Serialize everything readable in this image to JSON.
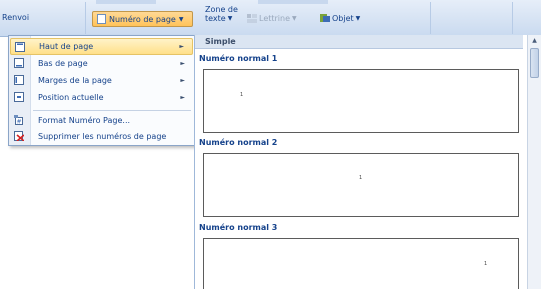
{
  "ribbon": {
    "renvoi": "Renvoi",
    "numero_de_page": "Numéro de page",
    "zone_de_texte_line1": "Zone de",
    "zone_de_texte_line2": "texte",
    "lettrine": "Lettrine",
    "objet": "Objet"
  },
  "menu": {
    "items": [
      {
        "label": "Haut de page",
        "has_submenu": true,
        "highlighted": true
      },
      {
        "label": "Bas de page",
        "has_submenu": true
      },
      {
        "label": "Marges de la page",
        "has_submenu": true
      },
      {
        "label": "Position actuelle",
        "has_submenu": true
      },
      {
        "label": "Format Numéro Page..."
      },
      {
        "label": "Supprimer les numéros de page"
      }
    ]
  },
  "gallery": {
    "header": "Simple",
    "entries": [
      {
        "label": "Numéro normal 1",
        "sample": "1"
      },
      {
        "label": "Numéro normal 2",
        "sample": "1"
      },
      {
        "label": "Numéro normal 3",
        "sample": "1"
      }
    ]
  },
  "colors": {
    "ribbon_text": "#15428b",
    "highlight": "#ffe08a",
    "menu_border": "#8ba5c8"
  }
}
